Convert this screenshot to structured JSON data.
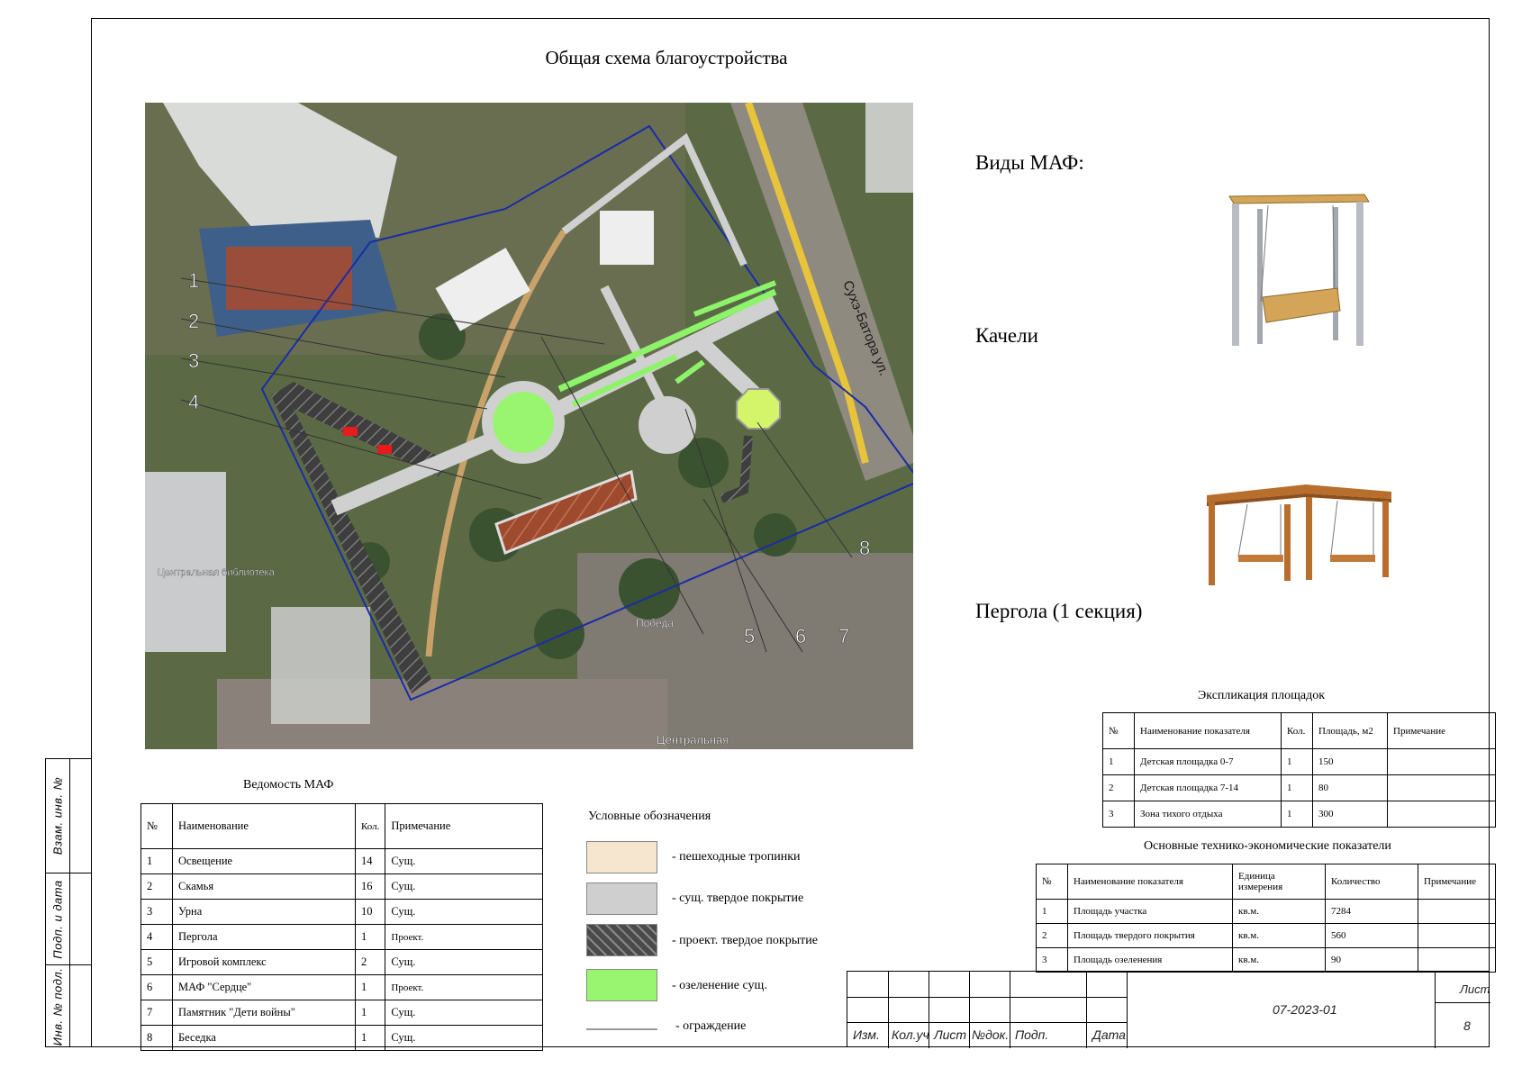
{
  "sheet": {
    "title": "Общая схема благоустройства",
    "side_stamp": [
      "Взам. инв. №",
      "Подп. и дата",
      "Инв. № подл."
    ]
  },
  "map": {
    "callouts": [
      "1",
      "2",
      "3",
      "4",
      "5",
      "6",
      "7",
      "8"
    ],
    "labels": {
      "street": "Сухэ-Батора ул.",
      "library": "Центральная библиотека",
      "pobeda": "Победа",
      "central": "Центральная"
    }
  },
  "maf_types": {
    "heading": "Виды МАФ:",
    "swing_label": "Качели",
    "pergola_label": "Пергола (1 секция)"
  },
  "maf_table": {
    "title": "Ведомость МАФ",
    "headers": [
      "№",
      "Наименование",
      "Кол.",
      "Примечание"
    ],
    "rows": [
      [
        "1",
        "Освещение",
        "14",
        "Сущ."
      ],
      [
        "2",
        "Скамья",
        "16",
        "Сущ."
      ],
      [
        "3",
        "Урна",
        "10",
        "Сущ."
      ],
      [
        "4",
        "Пергола",
        "1",
        "Проект."
      ],
      [
        "5",
        "Игровой комплекс",
        "2",
        "Сущ."
      ],
      [
        "6",
        "МАФ \"Сердце\"",
        "1",
        "Проект."
      ],
      [
        "7",
        "Памятник \"Дети войны\"",
        "1",
        "Сущ."
      ],
      [
        "8",
        "Беседка",
        "1",
        "Сущ."
      ]
    ]
  },
  "legend": {
    "title": "Условные обозначения",
    "items": [
      {
        "label": "- пешеходные тропинки",
        "color": "#f6e6cf"
      },
      {
        "label": "- сущ. твердое покрытие",
        "color": "#cfcfcf"
      },
      {
        "label": "- проект. твердое покрытие",
        "color": "#4a4a4a"
      },
      {
        "label": "- озеленение сущ.",
        "color": "#99f570"
      },
      {
        "label": "- ограждение",
        "color": "#9a9a9a"
      }
    ]
  },
  "explication": {
    "title": "Экспликация площадок",
    "headers": [
      "№",
      "Наименование показателя",
      "Кол.",
      "Площадь, м2",
      "Примечание"
    ],
    "rows": [
      [
        "1",
        "Детская площадка 0-7",
        "1",
        "150",
        ""
      ],
      [
        "2",
        "Детская площадка 7-14",
        "1",
        "80",
        ""
      ],
      [
        "3",
        "Зона тихого отдыха",
        "1",
        "300",
        ""
      ]
    ]
  },
  "tep": {
    "title": "Основные технико-экономические показатели",
    "headers": [
      "№",
      "Наименование показателя",
      "Единица измерения",
      "Количество",
      "Примечание"
    ],
    "rows": [
      [
        "1",
        "Площадь участка",
        "кв.м.",
        "7284",
        ""
      ],
      [
        "2",
        "Площадь твердого покрытия",
        "кв.м.",
        "560",
        ""
      ],
      [
        "3",
        "Площадь озеленения",
        "кв.м.",
        "90",
        ""
      ]
    ]
  },
  "stamp": {
    "code": "07-2023-01",
    "sheet_label": "Лист",
    "sheet_number": "8",
    "cols": [
      "Изм.",
      "Кол.уч",
      "Лист",
      "№док.",
      "Подп.",
      "Дата"
    ]
  }
}
